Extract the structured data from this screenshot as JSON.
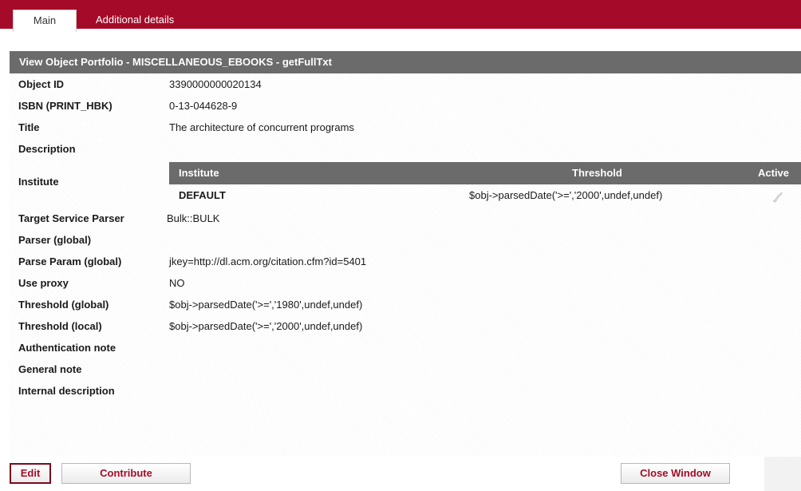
{
  "tabs": {
    "main": "Main",
    "additional": "Additional details"
  },
  "panel": {
    "title": "View Object Portfolio - MISCELLANEOUS_EBOOKS - getFullTxt"
  },
  "fields": {
    "object_id": {
      "label": "Object ID",
      "value": "3390000000020134"
    },
    "isbn": {
      "label": "ISBN (PRINT_HBK)",
      "value": "0-13-044628-9"
    },
    "title": {
      "label": "Title",
      "value": "The architecture of concurrent programs"
    },
    "description": {
      "label": "Description",
      "value": ""
    },
    "institute": {
      "label": "Institute"
    },
    "target_parser": {
      "label": "Target Service Parser",
      "value": "Bulk::BULK"
    },
    "parser_global": {
      "label": "Parser (global)",
      "value": ""
    },
    "parse_param": {
      "label": "Parse Param (global)",
      "value": "jkey=http://dl.acm.org/citation.cfm?id=5401"
    },
    "use_proxy": {
      "label": "Use proxy",
      "value": "NO"
    },
    "threshold_global": {
      "label": "Threshold (global)",
      "value": "$obj->parsedDate('>=','1980',undef,undef)"
    },
    "threshold_local": {
      "label": "Threshold (local)",
      "value": "$obj->parsedDate('>=','2000',undef,undef)"
    },
    "auth_note": {
      "label": "Authentication note",
      "value": ""
    },
    "general_note": {
      "label": "General note",
      "value": ""
    },
    "internal_desc": {
      "label": "Internal description",
      "value": ""
    }
  },
  "institute_table": {
    "headers": {
      "institute": "Institute",
      "threshold": "Threshold",
      "active": "Active"
    },
    "rows": [
      {
        "institute": "DEFAULT",
        "threshold": "$obj->parsedDate('>=','2000',undef,undef)",
        "active_icon": "check-icon"
      }
    ]
  },
  "buttons": {
    "edit": "Edit",
    "contribute": "Contribute",
    "close": "Close Window"
  },
  "colors": {
    "brand_red": "#a50b28",
    "header_gray": "#6b6b6b"
  }
}
